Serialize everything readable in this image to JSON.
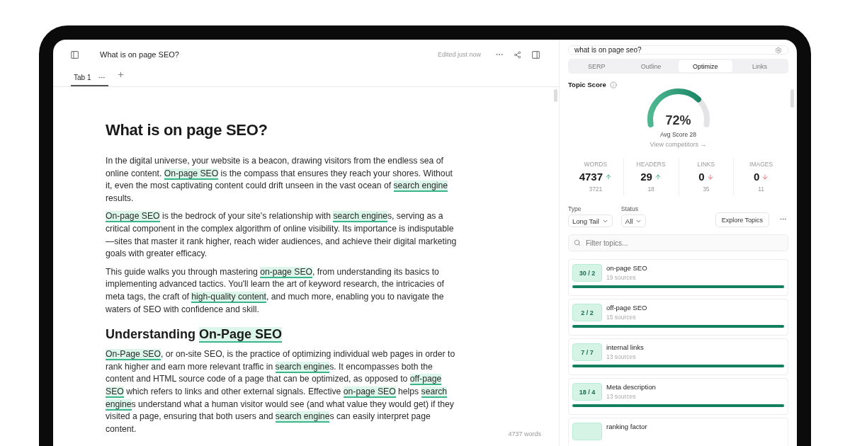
{
  "editor": {
    "title": "What is on page SEO?",
    "status": "Edited just now",
    "tabs": [
      {
        "label": "Tab 1",
        "selected": true
      }
    ],
    "heading": "What is on page SEO?",
    "blocks": [
      {
        "kind": "paragraph",
        "segments": [
          {
            "text": "In the digital universe, your website is a beacon, drawing visitors from the endless sea of online content. ",
            "highlighted": false
          },
          {
            "text": "On-page SEO",
            "highlighted": true
          },
          {
            "text": " is the compass that ensures they reach your shores. Without it, even the most captivating content could drift unseen in the vast ocean of ",
            "highlighted": false
          },
          {
            "text": "search engine",
            "highlighted": true
          },
          {
            "text": " results.",
            "highlighted": false
          }
        ]
      },
      {
        "kind": "paragraph",
        "segments": [
          {
            "text": "On-page SEO",
            "highlighted": true
          },
          {
            "text": " is the bedrock of your site's relationship with ",
            "highlighted": false
          },
          {
            "text": "search engine",
            "highlighted": true
          },
          {
            "text": "s, serving as a critical component in the complex algorithm of online visibility. Its importance is indisputable—sites that master it rank higher, reach wider audiences, and achieve their digital marketing goals with greater efficacy.",
            "highlighted": false
          }
        ]
      },
      {
        "kind": "paragraph",
        "segments": [
          {
            "text": "This guide walks you through mastering ",
            "highlighted": false
          },
          {
            "text": "on-page SEO",
            "highlighted": true
          },
          {
            "text": ", from understanding its basics to implementing advanced tactics. You'll learn the art of keyword research, the intricacies of meta tags, the craft of ",
            "highlighted": false
          },
          {
            "text": "high-quality content",
            "highlighted": true
          },
          {
            "text": ", and much more, enabling you to navigate the waters of SEO with confidence and skill.",
            "highlighted": false
          }
        ]
      },
      {
        "kind": "heading",
        "segments": [
          {
            "text": "Understanding ",
            "highlighted": false
          },
          {
            "text": "On-Page SEO",
            "highlighted": true
          }
        ]
      },
      {
        "kind": "paragraph",
        "segments": [
          {
            "text": "On-Page SEO",
            "highlighted": true
          },
          {
            "text": ", or on-site SEO, is the practice of optimizing individual web pages in order to rank higher and earn more relevant traffic in ",
            "highlighted": false
          },
          {
            "text": "search engine",
            "highlighted": true
          },
          {
            "text": "s. It encompasses both the content and HTML source code of a page that can be optimized, as opposed to ",
            "highlighted": false
          },
          {
            "text": "off-page SEO",
            "highlighted": true
          },
          {
            "text": " which refers to links and other external signals. Effective ",
            "highlighted": false
          },
          {
            "text": "on-page SEO",
            "highlighted": true
          },
          {
            "text": " helps ",
            "highlighted": false
          },
          {
            "text": "search engine",
            "highlighted": true
          },
          {
            "text": "s understand what a human visitor would see (and what value they would get) if they visited a page, ensuring that both users and ",
            "highlighted": false
          },
          {
            "text": "search engine",
            "highlighted": true
          },
          {
            "text": "s can easily interpret page content.",
            "highlighted": false
          }
        ]
      }
    ],
    "word_count": "4737 words"
  },
  "panel": {
    "query": "what is on page seo?",
    "tabs": [
      {
        "label": "SERP",
        "selected": false
      },
      {
        "label": "Outline",
        "selected": false
      },
      {
        "label": "Optimize",
        "selected": true
      },
      {
        "label": "Links",
        "selected": false
      }
    ],
    "topic_score": {
      "label": "Topic Score",
      "value": "72%",
      "avg": "Avg Score 28",
      "link": "View competitors →"
    },
    "stats": [
      {
        "label": "WORDS",
        "value": "4737",
        "rising": true,
        "target": "3721"
      },
      {
        "label": "HEADERS",
        "value": "29",
        "rising": true,
        "target": "18"
      },
      {
        "label": "LINKS",
        "value": "0",
        "rising": false,
        "target": "35"
      },
      {
        "label": "IMAGES",
        "value": "0",
        "rising": false,
        "target": "11"
      }
    ],
    "filters": [
      {
        "label": "Type",
        "value": "Long Tail"
      },
      {
        "label": "Status",
        "value": "All"
      }
    ],
    "explore_button": "Explore Topics",
    "filter_placeholder": "Filter topics...",
    "topics": [
      {
        "score": "30 / 2",
        "name": "on-page SEO",
        "sources": "19 sources",
        "level": 1
      },
      {
        "score": "2 / 2",
        "name": "off-page SEO",
        "sources": "15 sources",
        "level": 1
      },
      {
        "score": "7 / 7",
        "name": "internal links",
        "sources": "13 sources",
        "level": 1
      },
      {
        "score": "18 / 4",
        "name": "Meta description",
        "sources": "13 sources",
        "level": 1
      },
      {
        "name": "ranking factor"
      }
    ]
  }
}
